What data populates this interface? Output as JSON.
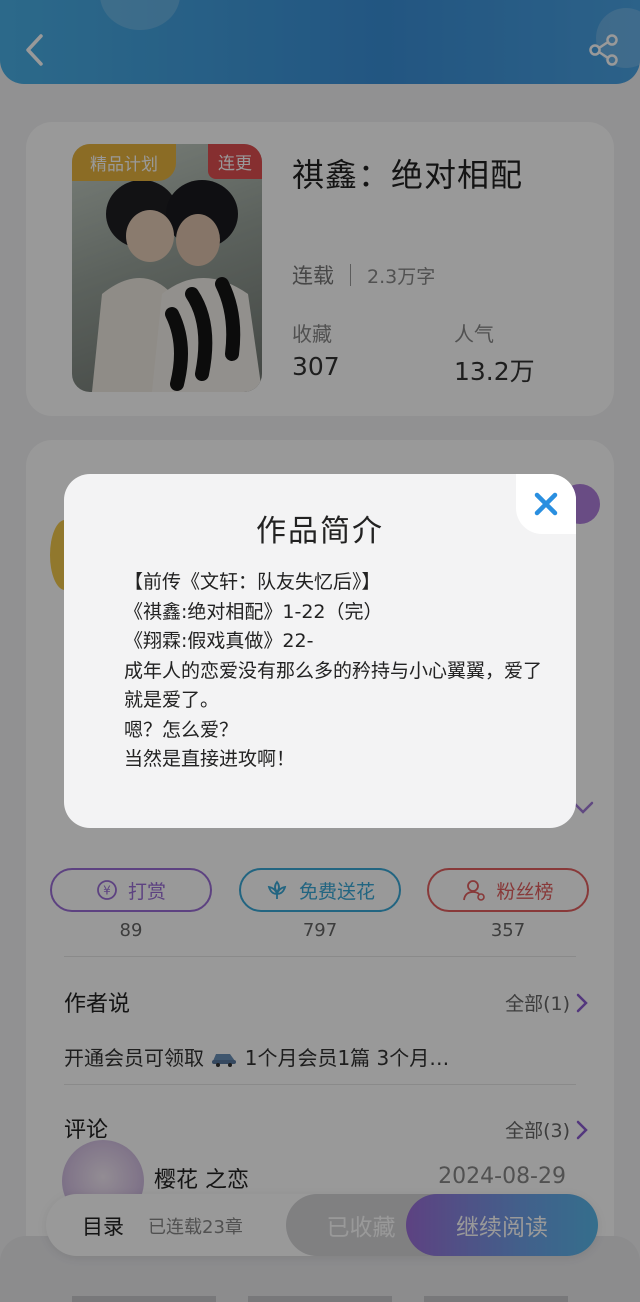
{
  "header": {
    "back_icon": "chevron-left-icon",
    "share_icon": "share-icon"
  },
  "book": {
    "title": "祺鑫：绝对相配",
    "cover_tag": "精品计划",
    "update_badge": "连更",
    "status": "连载",
    "word_count": "2.3万字",
    "favorites_label": "收藏",
    "favorites_value": "307",
    "popularity_label": "人气",
    "popularity_value": "13.2万"
  },
  "gifts": [
    {
      "label": "打赏",
      "icon": "yen-coin-icon",
      "count": "89",
      "color": "#9b6fd8"
    },
    {
      "label": "免费送花",
      "icon": "flower-icon",
      "count": "797",
      "color": "#3aa9d8"
    },
    {
      "label": "粉丝榜",
      "icon": "user-icon",
      "count": "357",
      "color": "#e36060"
    }
  ],
  "author_section": {
    "title": "作者说",
    "more": "全部(1)",
    "note_prefix": "开通会员可领取",
    "note_icon": "car-icon",
    "note_suffix": " 1个月会员1篇 3个月…"
  },
  "comments_section": {
    "title": "评论",
    "more": "全部(3)",
    "first_comment": {
      "user": "樱花 之恋",
      "date": "2024-08-29"
    }
  },
  "bottom_bar": {
    "toc": "目录",
    "toc_status": "已连载23章",
    "collected": "已收藏",
    "continue_reading": "继续阅读"
  },
  "modal": {
    "title": "作品简介",
    "lines": [
      "【前传《文轩：队友失忆后》】",
      "《祺鑫:绝对相配》1-22（完）",
      "《翔霖:假戏真做》22-",
      "成年人的恋爱没有那么多的矜持与小心翼翼，爱了就是爱了。",
      "嗯？怎么爱？",
      "当然是直接进攻啊！"
    ],
    "close_icon": "close-icon"
  },
  "colors": {
    "header_blue": "#3a8fd8",
    "accent_purple": "#9b6fd8",
    "close_blue": "#2a8fe0"
  }
}
